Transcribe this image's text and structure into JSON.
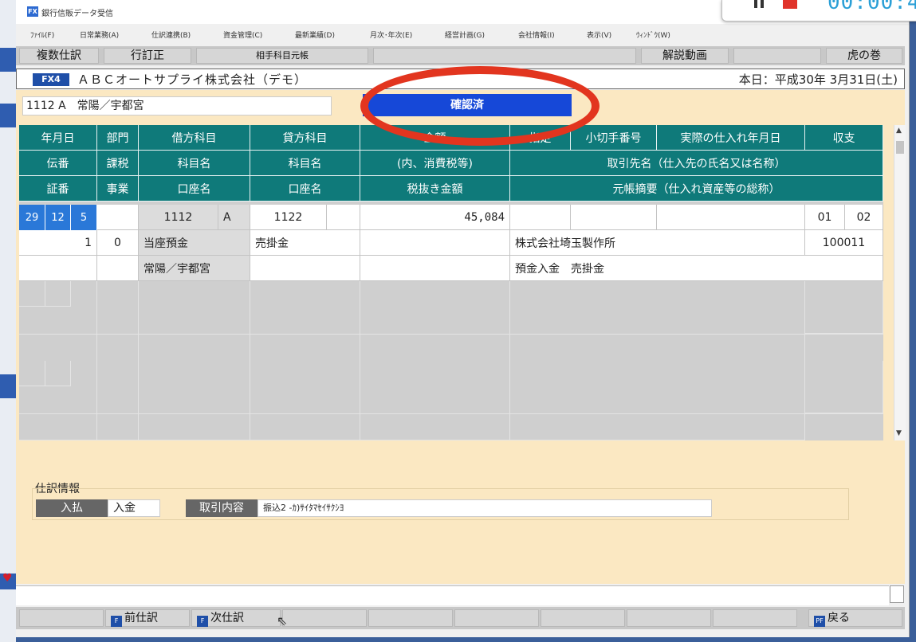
{
  "window": {
    "title": "銀行信販データ受信",
    "app_icon": "FX"
  },
  "recorder": {
    "timer": "00:00:4"
  },
  "menu": [
    "ﾌｧｲﾙ(F)",
    "日常業務(A)",
    "仕訳連携(B)",
    "資金管理(C)",
    "最新業績(D)",
    "月次･年次(E)",
    "経営計画(G)",
    "会社情報(I)",
    "表示(V)",
    "ｳｨﾝﾄﾞｳ(W)"
  ],
  "toolbar": {
    "b1": "複数仕訳",
    "b2": "行訂正",
    "b3": "相手科目元帳",
    "b4": "解説動画",
    "b5": "虎の巻"
  },
  "company": {
    "badge": "FX4",
    "name": "ＡＢＣオートサプライ株式会社（デモ）",
    "today": "本日：平成30年 3月31日(土)"
  },
  "account_field": "1112 A　常陽／宇都宮",
  "status_button": "確認済",
  "headers": {
    "r1": [
      "年月日",
      "部門",
      "借方科目",
      "貸方科目",
      "金額",
      "指定",
      "小切手番号",
      "実際の仕入れ年月日",
      "収支"
    ],
    "r2": [
      "伝番",
      "課税",
      "科目名",
      "科目名",
      "(内、消費税等)",
      "取引先名（仕入先の氏名又は名称）"
    ],
    "r3": [
      "証番",
      "事業",
      "口座名",
      "口座名",
      "税抜き金額",
      "元帳摘要（仕入れ資産等の総称）"
    ]
  },
  "entry": {
    "yy": "29",
    "mm": "12",
    "dd": "5",
    "debit_code": "1112",
    "debit_sub": "A",
    "credit_code": "1122",
    "amount": "45,084",
    "shushi1": "01",
    "shushi2": "02",
    "denban": "1",
    "kazei": "0",
    "debit_name": "当座預金",
    "credit_name": "売掛金",
    "partner": "株式会社埼玉製作所",
    "partner_code": "100011",
    "debit_account": "常陽／宇都宮",
    "memo": "預金入金　売掛金"
  },
  "info": {
    "section_label": "仕訳情報",
    "io_label": "入払",
    "io_value": "入金",
    "detail_label": "取引内容",
    "detail_value": "振込2 -ｶ)ｻｲﾀﾏｾｲｻｸｼﾖ"
  },
  "fnbar": {
    "prev_key": "F",
    "prev": "前仕訳",
    "next_key": "F",
    "next": "次仕訳",
    "back_key": "PF",
    "back": "戻る"
  },
  "colors": {
    "header": "#0f7a7a",
    "confirmed": "#1648d8",
    "annotation": "#e2351f",
    "form_bg": "#fbe8c2"
  }
}
